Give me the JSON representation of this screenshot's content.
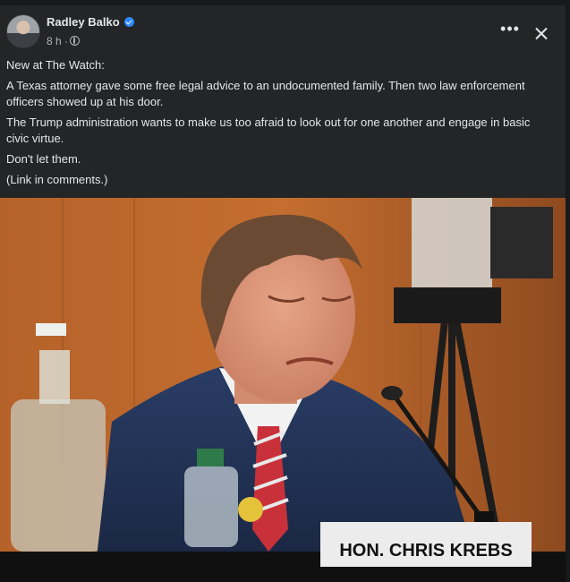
{
  "post": {
    "author": "Radley Balko",
    "verified_icon": "verified-badge-icon",
    "timestamp": "8 h",
    "separator": "·",
    "audience_icon": "globe-icon",
    "more_icon": "more-options-icon",
    "close_icon": "close-icon",
    "paragraphs": [
      "New at The Watch:",
      "A Texas attorney gave some free legal advice to an undocumented family. Then two law enforcement officers showed up at his door.",
      "The Trump administration wants to make us too afraid to look out for one another and engage in basic civic virtue.",
      "Don't let them.",
      "(Link in comments.)"
    ],
    "photo": {
      "nameplate_text": "HON. CHRIS KREBS"
    }
  },
  "colors": {
    "background": "#18191a",
    "card": "#242526",
    "text_primary": "#e4e6eb",
    "text_secondary": "#b0b3b8",
    "accent": "#2d88ff"
  }
}
